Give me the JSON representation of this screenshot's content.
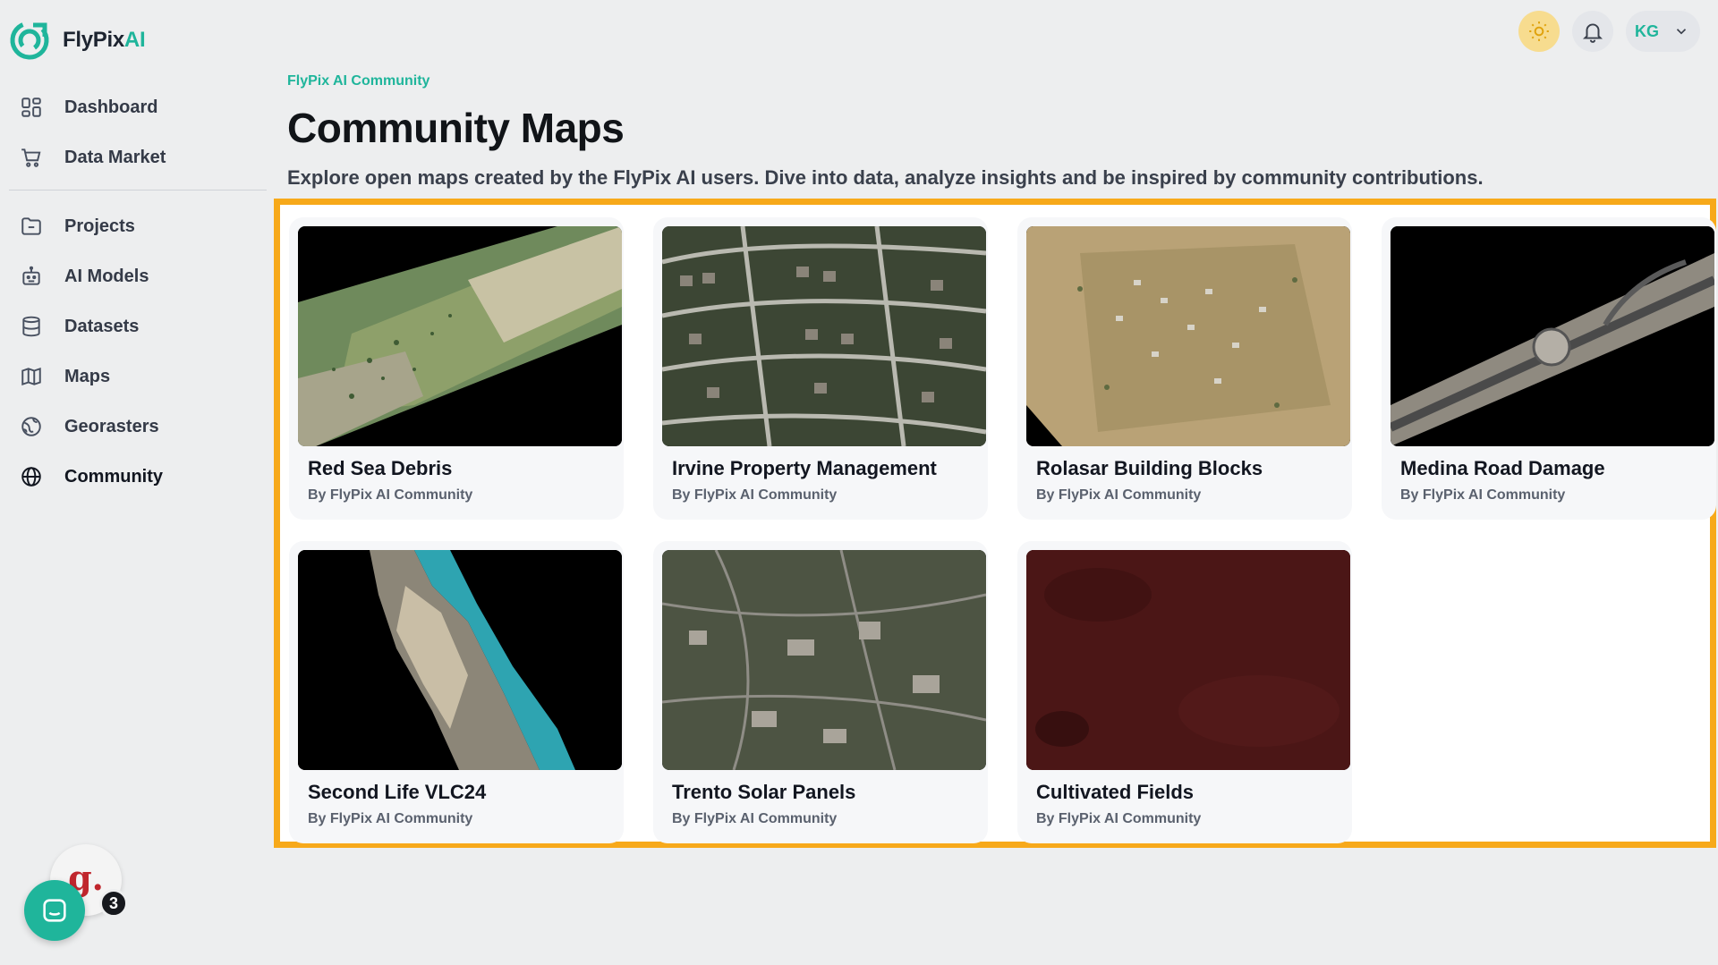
{
  "app": {
    "brand_main": "FlyPix",
    "brand_accent": "AI",
    "accent_color": "#1fb59b",
    "highlight_color": "#f7a91a"
  },
  "sidebar": {
    "items_top": [
      {
        "label": "Dashboard",
        "icon": "dashboard-icon"
      },
      {
        "label": "Data Market",
        "icon": "cart-icon"
      }
    ],
    "items_bottom": [
      {
        "label": "Projects",
        "icon": "folder-icon"
      },
      {
        "label": "AI Models",
        "icon": "robot-icon"
      },
      {
        "label": "Datasets",
        "icon": "database-icon"
      },
      {
        "label": "Maps",
        "icon": "map-icon"
      },
      {
        "label": "Georasters",
        "icon": "globe-grid-icon"
      },
      {
        "label": "Community",
        "icon": "globe-icon",
        "active": true
      }
    ]
  },
  "header": {
    "user_initials": "KG"
  },
  "main": {
    "breadcrumb": "FlyPix AI Community",
    "title": "Community Maps",
    "subtitle": "Explore open maps created by the FlyPix AI users. Dive into data, analyze insights and be inspired by community contributions.",
    "cards": [
      {
        "title": "Red Sea Debris",
        "by": "By FlyPix AI Community",
        "thumb": "aerial-strip-desert"
      },
      {
        "title": "Irvine Property Management",
        "by": "By FlyPix AI Community",
        "thumb": "aerial-suburb"
      },
      {
        "title": "Rolasar Building Blocks",
        "by": "By FlyPix AI Community",
        "thumb": "aerial-arid-village"
      },
      {
        "title": "Medina Road Damage",
        "by": "By FlyPix AI Community",
        "thumb": "aerial-road-strip"
      },
      {
        "title": "Second Life VLC24",
        "by": "By FlyPix AI Community",
        "thumb": "aerial-coastline"
      },
      {
        "title": "Trento Solar Panels",
        "by": "By FlyPix AI Community",
        "thumb": "aerial-town"
      },
      {
        "title": "Cultivated Fields",
        "by": "By FlyPix AI Community",
        "thumb": "aerial-dark-red-field"
      }
    ]
  },
  "widgets": {
    "g_letter": "g.",
    "notification_count": "3"
  }
}
